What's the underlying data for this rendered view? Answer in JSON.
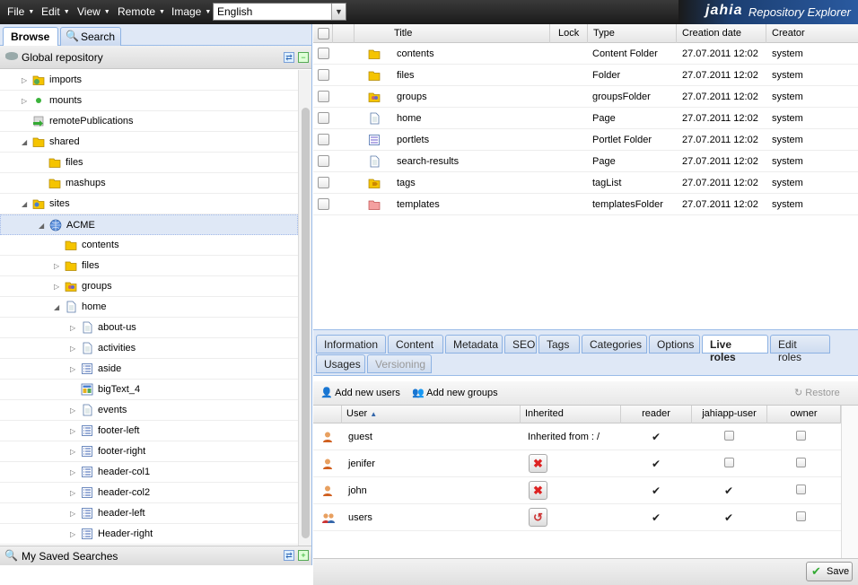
{
  "menubar": {
    "items": [
      "File",
      "Edit",
      "View",
      "Remote",
      "Image"
    ],
    "language": "English"
  },
  "brand": {
    "logo": "jahia",
    "title": "Repository Explorer"
  },
  "left_panel": {
    "tabs": [
      "Browse",
      "Search"
    ],
    "repo_header": "Global repository",
    "tree": [
      {
        "label": "imports",
        "icon": "imports-folder-icon",
        "indent": 0,
        "expander": "closed"
      },
      {
        "label": "mounts",
        "icon": "green-dot-icon",
        "indent": 0,
        "expander": "closed"
      },
      {
        "label": "remotePublications",
        "icon": "remote-publication-icon",
        "indent": 0,
        "expander": "none"
      },
      {
        "label": "shared",
        "icon": "folder-icon",
        "indent": 0,
        "expander": "open"
      },
      {
        "label": "files",
        "icon": "folder-icon",
        "indent": 1,
        "expander": "none"
      },
      {
        "label": "mashups",
        "icon": "folder-icon",
        "indent": 1,
        "expander": "none"
      },
      {
        "label": "sites",
        "icon": "sites-folder-icon",
        "indent": 0,
        "expander": "open"
      },
      {
        "label": "ACME",
        "icon": "globe-icon",
        "indent": 1,
        "expander": "open",
        "selected": true
      },
      {
        "label": "contents",
        "icon": "folder-icon",
        "indent": 2,
        "expander": "none"
      },
      {
        "label": "files",
        "icon": "folder-icon",
        "indent": 2,
        "expander": "closed"
      },
      {
        "label": "groups",
        "icon": "groups-folder-icon",
        "indent": 2,
        "expander": "closed"
      },
      {
        "label": "home",
        "icon": "page-icon",
        "indent": 2,
        "expander": "open"
      },
      {
        "label": "about-us",
        "icon": "page-icon",
        "indent": 3,
        "expander": "closed"
      },
      {
        "label": "activities",
        "icon": "page-icon",
        "indent": 3,
        "expander": "closed"
      },
      {
        "label": "aside",
        "icon": "list-icon",
        "indent": 3,
        "expander": "closed"
      },
      {
        "label": "bigText_4",
        "icon": "bigtext-icon",
        "indent": 3,
        "expander": "none"
      },
      {
        "label": "events",
        "icon": "page-icon",
        "indent": 3,
        "expander": "closed"
      },
      {
        "label": "footer-left",
        "icon": "list-icon",
        "indent": 3,
        "expander": "closed"
      },
      {
        "label": "footer-right",
        "icon": "list-icon",
        "indent": 3,
        "expander": "closed"
      },
      {
        "label": "header-col1",
        "icon": "list-icon",
        "indent": 3,
        "expander": "closed"
      },
      {
        "label": "header-col2",
        "icon": "list-icon",
        "indent": 3,
        "expander": "closed"
      },
      {
        "label": "header-left",
        "icon": "list-icon",
        "indent": 3,
        "expander": "closed"
      },
      {
        "label": "Header-right",
        "icon": "list-icon",
        "indent": 3,
        "expander": "closed"
      }
    ],
    "saved_searches": "My Saved Searches"
  },
  "grid": {
    "columns": [
      "Title",
      "Lock",
      "Type",
      "Creation date",
      "Creator"
    ],
    "rows": [
      {
        "title": "contents",
        "type": "Content Folder",
        "date": "27.07.2011 12:02",
        "creator": "system",
        "icon": "folder-icon"
      },
      {
        "title": "files",
        "type": "Folder",
        "date": "27.07.2011 12:02",
        "creator": "system",
        "icon": "folder-icon"
      },
      {
        "title": "groups",
        "type": "groupsFolder",
        "date": "27.07.2011 12:02",
        "creator": "system",
        "icon": "groups-folder-icon"
      },
      {
        "title": "home",
        "type": "Page",
        "date": "27.07.2011 12:02",
        "creator": "system",
        "icon": "page-icon"
      },
      {
        "title": "portlets",
        "type": "Portlet Folder",
        "date": "27.07.2011 12:02",
        "creator": "system",
        "icon": "portlet-icon"
      },
      {
        "title": "search-results",
        "type": "Page",
        "date": "27.07.2011 12:02",
        "creator": "system",
        "icon": "page-icon"
      },
      {
        "title": "tags",
        "type": "tagList",
        "date": "27.07.2011 12:02",
        "creator": "system",
        "icon": "tags-icon"
      },
      {
        "title": "templates",
        "type": "templatesFolder",
        "date": "27.07.2011 12:02",
        "creator": "system",
        "icon": "templates-folder-icon"
      }
    ]
  },
  "detail_tabs": {
    "row1": [
      "Information",
      "Content",
      "Metadata",
      "SEO",
      "Tags",
      "Categories",
      "Options",
      "Live roles",
      "Edit roles"
    ],
    "row2": [
      "Usages",
      "Versioning"
    ],
    "active": "Live roles"
  },
  "roles": {
    "add_users": "Add new users",
    "add_groups": "Add new groups",
    "restore": "Restore",
    "columns": [
      "User",
      "Inherited",
      "reader",
      "jahiapp-user",
      "owner"
    ],
    "rows": [
      {
        "user": "guest",
        "inherited": "Inherited from : /",
        "reader": true,
        "jahiapp_user": false,
        "owner": false,
        "icon": "user-icon"
      },
      {
        "user": "jenifer",
        "inherited": "",
        "reader": true,
        "jahiapp_user": false,
        "owner": false,
        "icon": "user-icon"
      },
      {
        "user": "john",
        "inherited": "",
        "reader": true,
        "jahiapp_user": true,
        "owner": false,
        "icon": "user-icon"
      },
      {
        "user": "users",
        "inherited": "",
        "reader": true,
        "jahiapp_user": true,
        "owner": false,
        "icon": "group-icon"
      }
    ],
    "save": "Save"
  }
}
